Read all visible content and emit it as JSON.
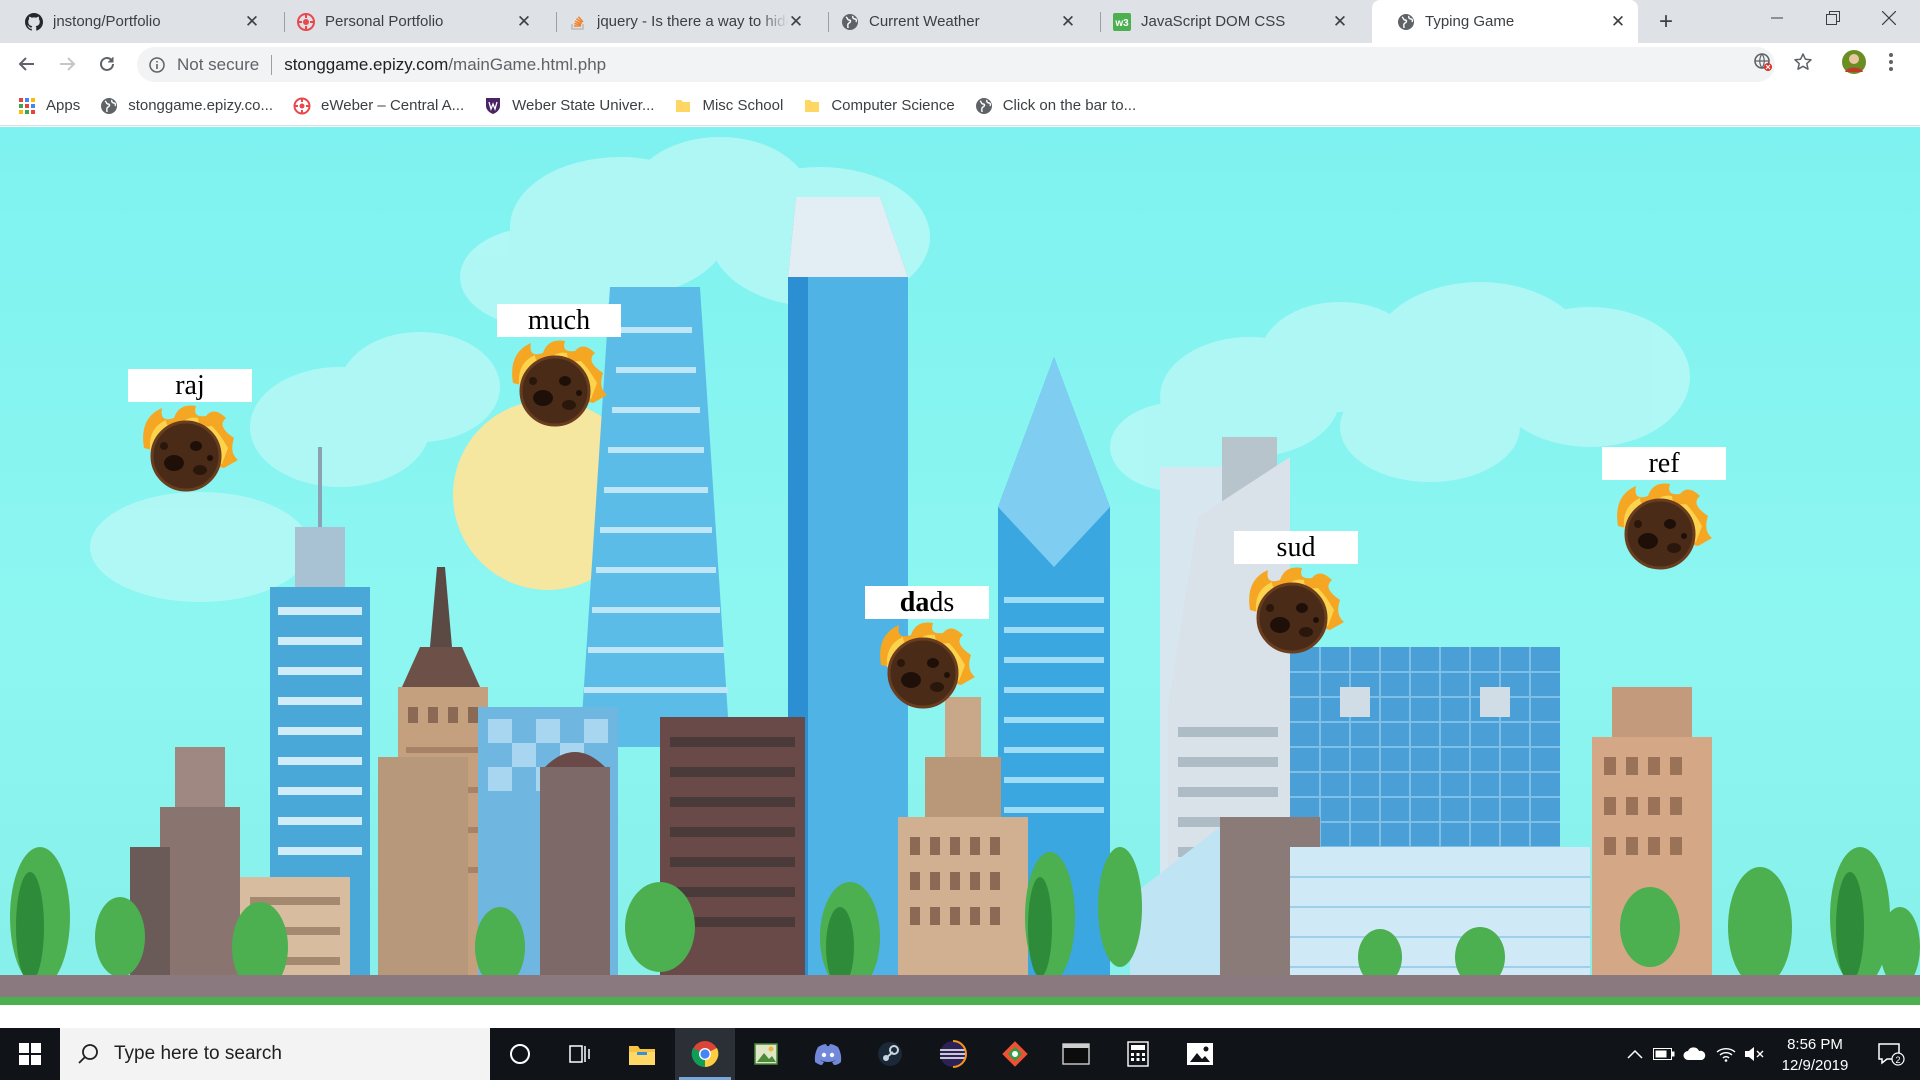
{
  "browser": {
    "tabs": [
      {
        "title": "jnstong/Portfolio",
        "favicon": "github-icon",
        "active": false
      },
      {
        "title": "Personal Portfolio",
        "favicon": "portfolio-icon",
        "active": false
      },
      {
        "title": "jquery - Is there a way to hide",
        "favicon": "stackoverflow-icon",
        "active": false
      },
      {
        "title": "Current Weather",
        "favicon": "globe-icon",
        "active": false
      },
      {
        "title": "JavaScript DOM CSS",
        "favicon": "w3-icon",
        "active": false
      },
      {
        "title": "Typing Game",
        "favicon": "globe-icon",
        "active": true
      }
    ],
    "close_glyph": "✕",
    "new_tab_glyph": "+",
    "address": {
      "security_label": "Not secure",
      "host": "stonggame.epizy.com",
      "path": "/mainGame.html.php"
    },
    "bookmarks": [
      {
        "label": "Apps",
        "icon": "apps-grid-icon"
      },
      {
        "label": "stonggame.epizy.co...",
        "icon": "globe-icon"
      },
      {
        "label": "eWeber – Central A...",
        "icon": "eweber-icon"
      },
      {
        "label": "Weber State Univer...",
        "icon": "weber-shield-icon"
      },
      {
        "label": "Misc School",
        "icon": "folder-icon"
      },
      {
        "label": "Computer Science",
        "icon": "folder-icon"
      },
      {
        "label": "Click on the bar to...",
        "icon": "globe-icon"
      }
    ]
  },
  "game": {
    "meteors": [
      {
        "typed": "",
        "rest": "raj"
      },
      {
        "typed": "",
        "rest": "much"
      },
      {
        "typed": "da",
        "rest": "ds"
      },
      {
        "typed": "",
        "rest": "sud"
      },
      {
        "typed": "",
        "rest": "ref"
      }
    ]
  },
  "taskbar": {
    "search_placeholder": "Type here to search",
    "time": "8:56 PM",
    "date": "12/9/2019",
    "notification_count": "2",
    "pinned": [
      "cortana-icon",
      "task-view-icon",
      "file-explorer-icon",
      "chrome-icon",
      "photo-editor-icon",
      "discord-icon",
      "steam-icon",
      "eclipse-icon",
      "git-icon",
      "terminal-icon",
      "calculator-icon",
      "photos-icon"
    ]
  }
}
